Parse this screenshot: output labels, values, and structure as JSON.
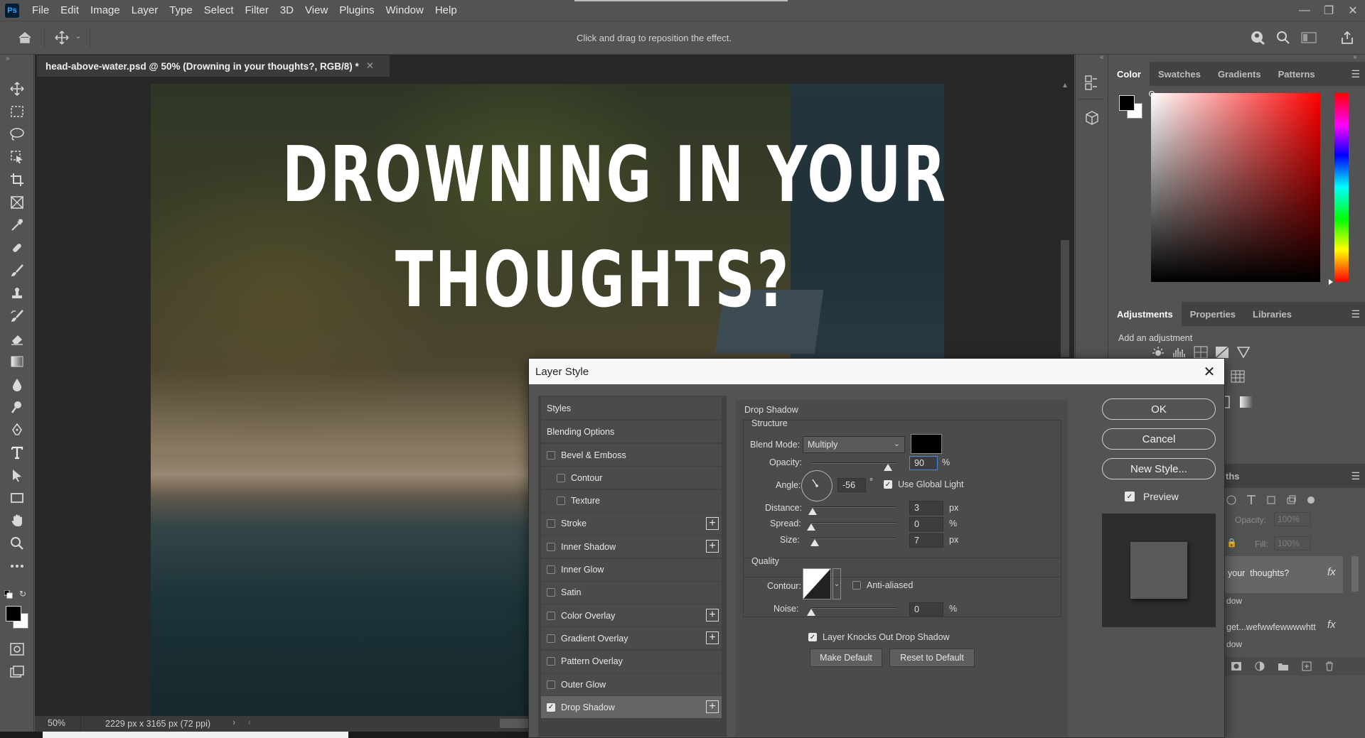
{
  "app": {
    "logo": "Ps"
  },
  "menu": [
    "File",
    "Edit",
    "Image",
    "Layer",
    "Type",
    "Select",
    "Filter",
    "3D",
    "View",
    "Plugins",
    "Window",
    "Help"
  ],
  "options_bar": {
    "hint": "Click and drag to reposition the effect."
  },
  "document": {
    "tab_title": "head-above-water.psd @ 50% (Drowning in your  thoughts?, RGB/8) *",
    "headline_line1": "DROWNING IN YOUR",
    "headline_line2": "THOUGHTS?",
    "zoom": "50%",
    "doc_info": "2229 px x 3165 px (72 ppi)"
  },
  "color_panel": {
    "tabs": [
      "Color",
      "Swatches",
      "Gradients",
      "Patterns"
    ],
    "active_tab": "Color",
    "foreground": "#000000",
    "background": "#ffffff",
    "hue_color": "#ff0000"
  },
  "adjustments_panel": {
    "tabs": [
      "Adjustments",
      "Properties",
      "Libraries"
    ],
    "add_label": "Add an adjustment"
  },
  "layers_panel": {
    "tab_fragment": "ths",
    "opacity_label": "Opacity:",
    "opacity_value": "100%",
    "fill_label": "Fill:",
    "fill_value": "100%",
    "layer1_name": "your  thoughts?",
    "layer1_fx": "fx",
    "layer1_effect": "dow",
    "layer2_name": "get...wefwwfewwwwhtt",
    "layer2_fx": "fx",
    "layer2_effect": "dow"
  },
  "dialog": {
    "title": "Layer Style",
    "styles_header": "Styles",
    "blending_options": "Blending Options",
    "style_items": [
      {
        "label": "Bevel & Emboss",
        "checked": false,
        "plus": false,
        "indent": false
      },
      {
        "label": "Contour",
        "checked": false,
        "plus": false,
        "indent": true
      },
      {
        "label": "Texture",
        "checked": false,
        "plus": false,
        "indent": true
      },
      {
        "label": "Stroke",
        "checked": false,
        "plus": true,
        "indent": false
      },
      {
        "label": "Inner Shadow",
        "checked": false,
        "plus": true,
        "indent": false
      },
      {
        "label": "Inner Glow",
        "checked": false,
        "plus": false,
        "indent": false
      },
      {
        "label": "Satin",
        "checked": false,
        "plus": false,
        "indent": false
      },
      {
        "label": "Color Overlay",
        "checked": false,
        "plus": true,
        "indent": false
      },
      {
        "label": "Gradient Overlay",
        "checked": false,
        "plus": true,
        "indent": false
      },
      {
        "label": "Pattern Overlay",
        "checked": false,
        "plus": false,
        "indent": false
      },
      {
        "label": "Outer Glow",
        "checked": false,
        "plus": false,
        "indent": false
      },
      {
        "label": "Drop Shadow",
        "checked": true,
        "plus": true,
        "indent": false
      }
    ],
    "drop_shadow": {
      "section_title": "Drop Shadow",
      "structure_title": "Structure",
      "blend_mode_label": "Blend Mode:",
      "blend_mode": "Multiply",
      "shadow_color": "#000000",
      "opacity_label": "Opacity:",
      "opacity": "90",
      "opacity_unit": "%",
      "angle_label": "Angle:",
      "angle": "-56",
      "angle_unit": "°",
      "use_global_light": "Use Global Light",
      "distance_label": "Distance:",
      "distance": "3",
      "distance_unit": "px",
      "spread_label": "Spread:",
      "spread": "0",
      "spread_unit": "%",
      "size_label": "Size:",
      "size": "7",
      "size_unit": "px",
      "quality_title": "Quality",
      "contour_label": "Contour:",
      "anti_aliased": "Anti-aliased",
      "noise_label": "Noise:",
      "noise": "0",
      "noise_unit": "%",
      "knocks_out": "Layer Knocks Out Drop Shadow",
      "make_default": "Make Default",
      "reset_default": "Reset to Default",
      "opacity_level": 0.9,
      "distance_level": 0.02,
      "spread_level": 0.0,
      "size_level": 0.04,
      "noise_level": 0.0
    },
    "buttons": {
      "ok": "OK",
      "cancel": "Cancel",
      "new_style": "New Style...",
      "preview": "Preview"
    }
  }
}
